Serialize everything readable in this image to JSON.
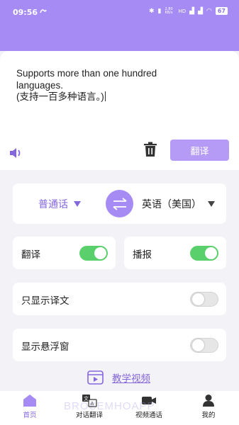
{
  "status_bar": {
    "time": "09:56",
    "network_speed": "2.80 KB/s",
    "battery": "67"
  },
  "input": {
    "line1": "Supports more than one hundred",
    "line2": "languages.",
    "line3": "(支持一百多种语言。)"
  },
  "actions": {
    "translate_label": "翻译"
  },
  "languages": {
    "source": "普通话",
    "target": "英语（美国）"
  },
  "toggles": {
    "translate": {
      "label": "翻译",
      "on": true
    },
    "broadcast": {
      "label": "播报",
      "on": true
    },
    "only_translation": {
      "label": "只显示译文",
      "on": false
    },
    "floating_window": {
      "label": "显示悬浮窗",
      "on": false
    }
  },
  "tutorial": {
    "label": "教学视频"
  },
  "nav": {
    "home": "首页",
    "dialog": "对话翻译",
    "video": "视频通话",
    "mine": "我的"
  },
  "watermark": "BROSEMHOAPP",
  "colors": {
    "accent": "#a58bf3",
    "accent_text": "#8466dd",
    "switch_on": "#59d06b"
  }
}
